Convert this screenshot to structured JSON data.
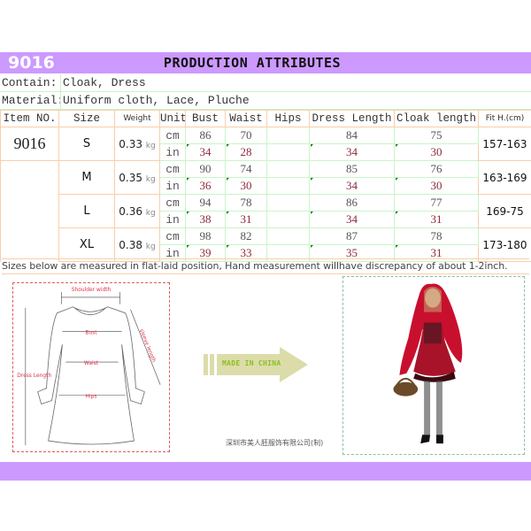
{
  "header": {
    "item_id": "9016",
    "title": "PRODUCTION ATTRIBUTES",
    "accent_color": "#cc99ff"
  },
  "info": {
    "contain_label": "Contain:",
    "contain_value": "Cloak, Dress",
    "material_label": "Material:",
    "material_value": "Uniform cloth, Lace, Pluche"
  },
  "table": {
    "headers": [
      "Item NO.",
      "Size",
      "Weight",
      "Unit",
      "Bust",
      "Waist",
      "Hips",
      "Dress Length",
      "Cloak length",
      "Fit H.(cm)"
    ],
    "item_no": "9016",
    "rows": [
      {
        "size": "S",
        "weight": "0.33",
        "weight_unit": "kg",
        "fit": "157-163",
        "cm": {
          "unit": "cm",
          "bust": "86",
          "waist": "70",
          "hips": "",
          "dress_length": "84",
          "cloak_length": "75"
        },
        "in": {
          "unit": "in",
          "bust": "34",
          "waist": "28",
          "hips": "",
          "dress_length": "34",
          "cloak_length": "30"
        }
      },
      {
        "size": "M",
        "weight": "0.35",
        "weight_unit": "kg",
        "fit": "163-169",
        "cm": {
          "unit": "cm",
          "bust": "90",
          "waist": "74",
          "hips": "",
          "dress_length": "85",
          "cloak_length": "76"
        },
        "in": {
          "unit": "in",
          "bust": "36",
          "waist": "30",
          "hips": "",
          "dress_length": "34",
          "cloak_length": "30"
        }
      },
      {
        "size": "L",
        "weight": "0.36",
        "weight_unit": "kg",
        "fit": "169-75",
        "cm": {
          "unit": "cm",
          "bust": "94",
          "waist": "78",
          "hips": "",
          "dress_length": "86",
          "cloak_length": "77"
        },
        "in": {
          "unit": "in",
          "bust": "38",
          "waist": "31",
          "hips": "",
          "dress_length": "34",
          "cloak_length": "31"
        }
      },
      {
        "size": "XL",
        "weight": "0.38",
        "weight_unit": "kg",
        "fit": "173-180",
        "cm": {
          "unit": "cm",
          "bust": "98",
          "waist": "82",
          "hips": "",
          "dress_length": "87",
          "cloak_length": "78"
        },
        "in": {
          "unit": "in",
          "bust": "39",
          "waist": "33",
          "hips": "",
          "dress_length": "35",
          "cloak_length": "31"
        }
      }
    ]
  },
  "note": "Sizes below are measured in flat-laid position, Hand measurement willhave discrepancy of about 1-2inch.",
  "diagram": {
    "shoulder_width": "Shoulder width",
    "bust": "Bust",
    "waist": "Waist",
    "hips": "Hips",
    "dress_length": "Dress Length",
    "sleeve_length": "sleeve length"
  },
  "arrow_label": "MADE IN CHINA",
  "company": "深圳市美人胚服饰有限公司(制)",
  "photo_alt": "Red riding hood costume model photo"
}
